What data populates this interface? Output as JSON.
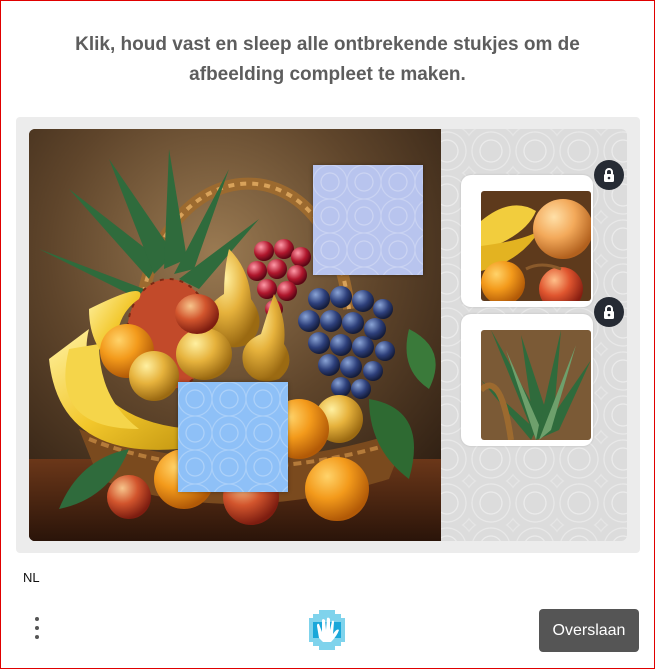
{
  "instruction": "Klik, houd vast en sleep alle ontbrekende stukjes om de afbeelding compleet te maken.",
  "puzzle": {
    "image_subject": "Fruit basket painting with bananas, pineapple, pears, grapes, apples and oranges",
    "missing_slots": 2,
    "pieces": [
      {
        "name": "apples-bananas-piece",
        "locked": true
      },
      {
        "name": "pineapple-leaves-piece",
        "locked": true
      }
    ]
  },
  "footer": {
    "language": "NL",
    "skip_label": "Overslaan",
    "menu_icon": "more-vertical-icon",
    "logo_icon": "hand-logo-icon"
  },
  "colors": {
    "border": "#e00000",
    "title": "#5d5d5d",
    "button_bg": "#555555",
    "hole_top": "#b8c4ee",
    "hole_bottom": "#8ec0f7",
    "lock_bg": "#262b34"
  }
}
